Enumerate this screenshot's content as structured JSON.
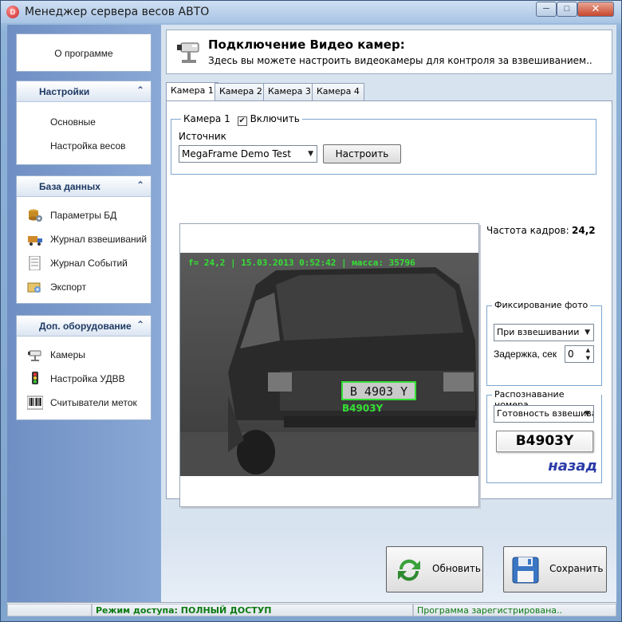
{
  "window": {
    "title": "Менеджер сервера весов АВТО",
    "minimize": "─",
    "maximize": "□",
    "close": "✕"
  },
  "sidebar": {
    "about": "О программе",
    "settings": {
      "title": "Настройки",
      "items": [
        "Основные",
        "Настройка весов"
      ]
    },
    "database": {
      "title": "База данных",
      "items": [
        "Параметры БД",
        "Журнал взвешиваний",
        "Журнал Событий",
        "Экспорт"
      ]
    },
    "equipment": {
      "title": "Доп. оборудование",
      "items": [
        "Камеры",
        "Настройка УДВВ",
        "Считыватели меток"
      ]
    },
    "collapse_glyph": "⌃"
  },
  "header": {
    "title": "Подключение Видео камер:",
    "subtitle": "Здесь вы можете настроить видеокамеры для контроля за взвешиванием.."
  },
  "tabs": [
    "Камера 1",
    "Камера 2",
    "Камера 3",
    "Камера 4"
  ],
  "camera": {
    "group_label": "Камера 1",
    "enable_label": "Включить",
    "enabled": true,
    "source_label": "Источник",
    "source_value": "MegaFrame Demo Test",
    "configure_button": "Настроить"
  },
  "video": {
    "osd": "f= 24,2 | 15.03.2013 0:52:42 | масса: 35796",
    "plate_box_text": "B 4903 Y",
    "plate_under_text": "B4903Y"
  },
  "fps": {
    "label": "Частота кадров:",
    "value": "24,2"
  },
  "photo_fix": {
    "title": "Фиксирование фото",
    "mode": "При взвешивании",
    "delay_label": "Задержка, сек",
    "delay_value": "0"
  },
  "recognition": {
    "title": "Распознавание номера",
    "mode": "Готовность взвешива",
    "plate": "B4903Y",
    "direction": "назад"
  },
  "actions": {
    "refresh": "Обновить",
    "save": "Сохранить"
  },
  "status": {
    "access": "Режим доступа: ПОЛНЫЙ ДОСТУП",
    "registration": "Программа зарегистрирована.."
  },
  "colors": {
    "osd_green": "#35e035",
    "status_green": "#0c7a13",
    "direction_blue": "#2a3aa8"
  }
}
